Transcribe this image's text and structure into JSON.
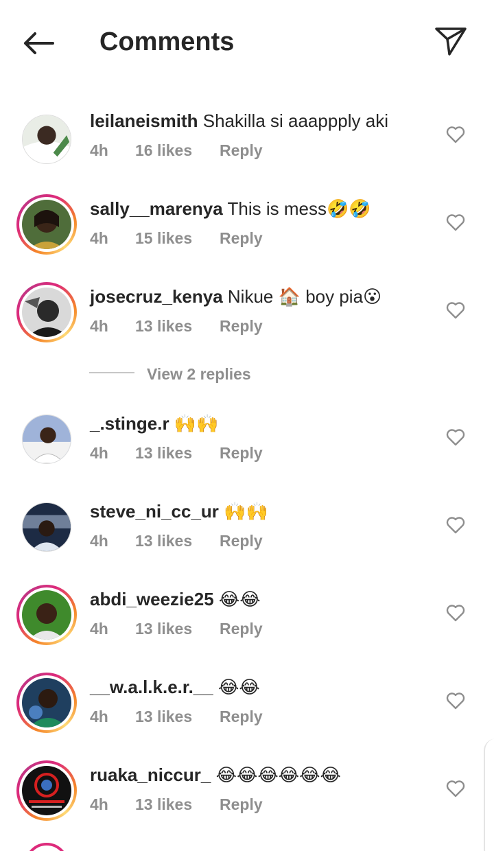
{
  "header": {
    "title": "Comments",
    "back_icon": "arrow-left-icon",
    "share_icon": "paper-plane-icon"
  },
  "colors": {
    "text": "#262626",
    "secondary": "#8e8e8e",
    "story_ring": "#dd2a7b"
  },
  "comments": [
    {
      "username": "leilaneismith",
      "text": "Shakilla si aaappply aki",
      "emoji": "",
      "time": "4h",
      "likes": "16 likes",
      "reply": "Reply",
      "story_ring": false
    },
    {
      "username": "sally__marenya",
      "text": "This is mess",
      "emoji": "🤣🤣",
      "time": "4h",
      "likes": "15 likes",
      "reply": "Reply",
      "story_ring": true
    },
    {
      "username": "josecruz_kenya",
      "text": "Nikue 🏠 boy pia",
      "emoji": "😮",
      "time": "4h",
      "likes": "13 likes",
      "reply": "Reply",
      "story_ring": true
    },
    {
      "username": "_.stinge.r",
      "text": "",
      "emoji": "🙌🙌",
      "time": "4h",
      "likes": "13 likes",
      "reply": "Reply",
      "story_ring": false
    },
    {
      "username": "steve_ni_cc_ur",
      "text": "",
      "emoji": "🙌🙌",
      "time": "4h",
      "likes": "13 likes",
      "reply": "Reply",
      "story_ring": false
    },
    {
      "username": "abdi_weezie25",
      "text": "",
      "emoji": "😂😂",
      "time": "4h",
      "likes": "13 likes",
      "reply": "Reply",
      "story_ring": true
    },
    {
      "username": "__w.a.l.k.e.r.__",
      "text": "",
      "emoji": "😂😂",
      "time": "4h",
      "likes": "13 likes",
      "reply": "Reply",
      "story_ring": true
    },
    {
      "username": "ruaka_niccur_",
      "text": "",
      "emoji": "😂😂😂😂😂😂",
      "time": "4h",
      "likes": "13 likes",
      "reply": "Reply",
      "story_ring": true
    }
  ],
  "view_replies": {
    "label": "View 2 replies"
  }
}
